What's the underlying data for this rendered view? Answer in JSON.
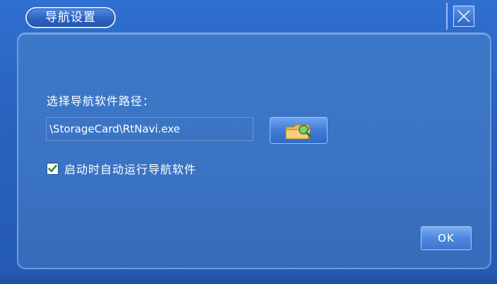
{
  "window": {
    "title": "导航设置"
  },
  "icons": {
    "close": "close-icon",
    "browse": "folder-search-icon",
    "check": "checkmark-icon"
  },
  "form": {
    "path_label": "选择导航软件路径：",
    "path_value": "\\StorageCard\\RtNavi.exe",
    "autostart_label": "启动时自动运行导航软件",
    "autostart_checked": true
  },
  "buttons": {
    "ok_label": "OK"
  },
  "colors": {
    "background": "#2f6fd0",
    "panel": "#3d78c8",
    "text": "#ffffff",
    "check": "#1f8a2a"
  }
}
